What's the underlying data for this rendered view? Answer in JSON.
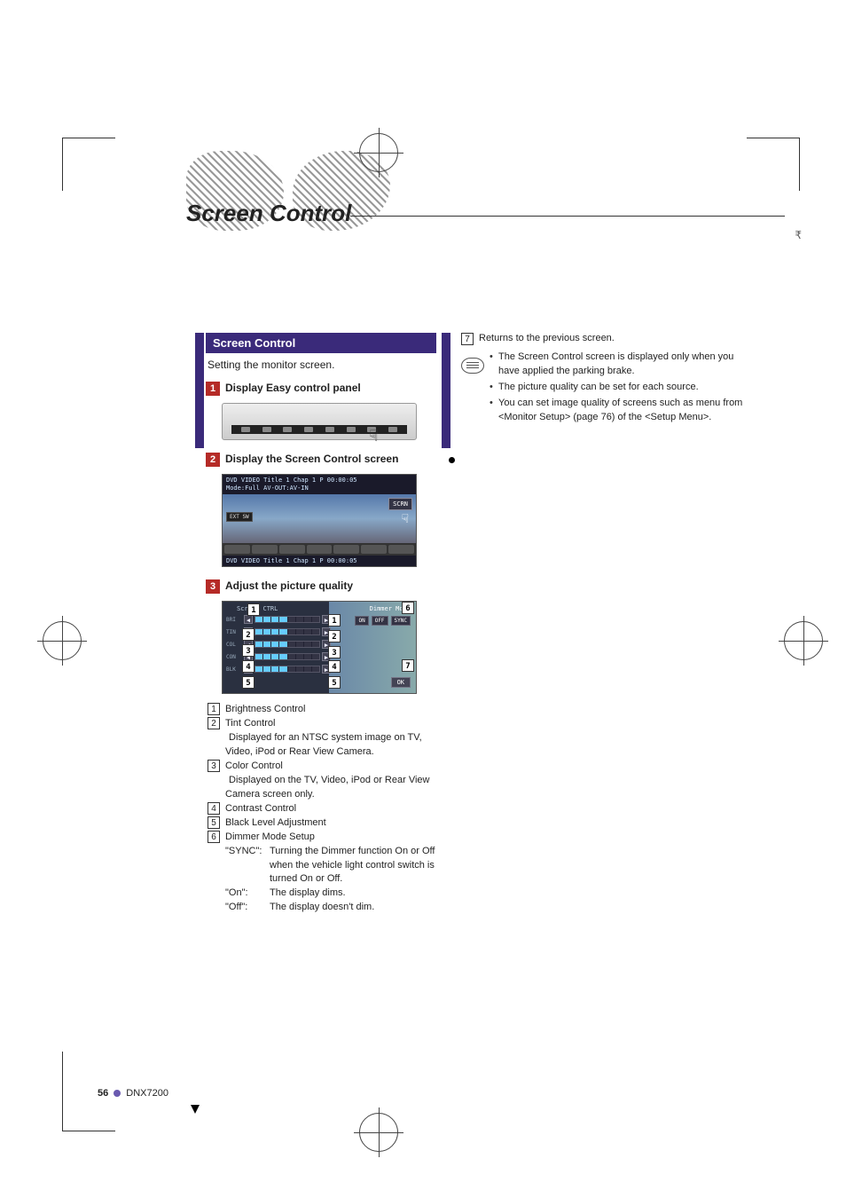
{
  "page_title": "Screen Control",
  "section_bar": "Screen Control",
  "lead_text": "Setting the monitor screen.",
  "steps": [
    {
      "num": "1",
      "title": "Display Easy control panel"
    },
    {
      "num": "2",
      "title": "Display the Screen Control screen"
    },
    {
      "num": "3",
      "title": "Adjust the picture quality"
    }
  ],
  "dvd_screenshot": {
    "top_line1": "DVD VIDEO   Title  1   Chap   1   P 00:00:05",
    "top_line2": "                 Mode:Full     AV-OUT:AV-IN",
    "scrn_button": "SCRN",
    "extsw_button": "EXT SW",
    "bottom_line": "DVD VIDEO   Title  1   Chap   1   P 00:00:05"
  },
  "adjust_screenshot": {
    "panel_title": "Screen CTRL",
    "sliders": [
      "BRI",
      "TIN",
      "COL",
      "CON",
      "BLK"
    ],
    "dimmer_label": "Dimmer  Mode",
    "dimmer_options": [
      "ON",
      "OFF",
      "SYNC"
    ],
    "ok": "OK"
  },
  "definitions": [
    {
      "num": "1",
      "label": "Brightness Control"
    },
    {
      "num": "2",
      "label": "Tint Control",
      "sub": "Displayed for an NTSC system image on TV, Video, iPod or Rear View Camera."
    },
    {
      "num": "3",
      "label": "Color Control",
      "sub": "Displayed on the TV, Video, iPod or Rear View Camera screen only."
    },
    {
      "num": "4",
      "label": "Contrast Control"
    },
    {
      "num": "5",
      "label": "Black Level Adjustment"
    },
    {
      "num": "6",
      "label": "Dimmer Mode Setup"
    }
  ],
  "dimmer_modes": [
    {
      "key": "\"SYNC\":",
      "val": "Turning the Dimmer function On or Off when the vehicle light control switch is turned On or Off."
    },
    {
      "key": "\"On\":",
      "val": "The display dims."
    },
    {
      "key": "\"Off\":",
      "val": "The display doesn't dim."
    }
  ],
  "right_col": {
    "return_num": "7",
    "return_text": "Returns to the previous screen.",
    "notes": [
      "The Screen Control screen is displayed only when you have applied the parking brake.",
      "The picture quality can be set for each source.",
      "You can set image quality of screens such as menu from <Monitor Setup> (page 76) of the <Setup Menu>."
    ]
  },
  "footer": {
    "page": "56",
    "model": "DNX7200"
  }
}
